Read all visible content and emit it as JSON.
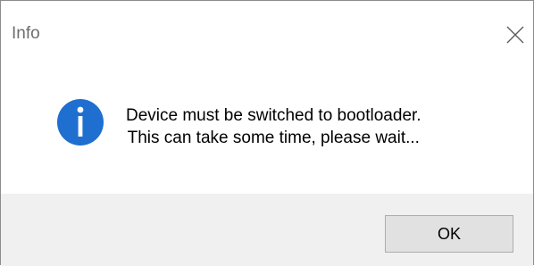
{
  "window": {
    "title": "Info"
  },
  "message": {
    "line1": "Device must be switched to bootloader.",
    "line2": "This can take some time, please wait..."
  },
  "buttons": {
    "ok_label": "OK"
  },
  "icons": {
    "close": "close-icon",
    "info": "info-icon"
  },
  "colors": {
    "info_icon_blue": "#1e6fd0",
    "footer_bg": "#f0f0f0",
    "button_bg": "#e1e1e1",
    "button_border": "#adadad"
  }
}
